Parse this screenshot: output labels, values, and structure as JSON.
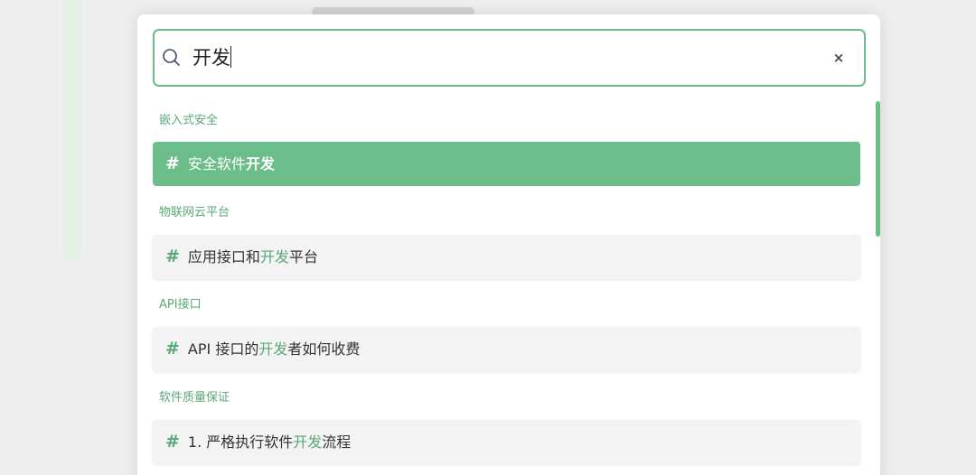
{
  "search": {
    "query": "开发",
    "clear_label": "×"
  },
  "colors": {
    "accent": "#6bbd8a",
    "accent_text": "#5aa877",
    "hit_bg": "#f3f3f4"
  },
  "results": [
    {
      "category": "嵌入式安全",
      "hash": "#",
      "prefix": "安全软件",
      "highlight": "开发",
      "suffix": "",
      "active": true
    },
    {
      "category": "物联网云平台",
      "hash": "#",
      "prefix": "应用接口和",
      "highlight": "开发",
      "suffix": "平台",
      "active": false
    },
    {
      "category": "API接口",
      "hash": "#",
      "prefix": "API 接口的",
      "highlight": "开发",
      "suffix": "者如何收费",
      "active": false
    },
    {
      "category": "软件质量保证",
      "hash": "#",
      "prefix": "1. 严格执行软件",
      "highlight": "开发",
      "suffix": "流程",
      "active": false
    }
  ]
}
